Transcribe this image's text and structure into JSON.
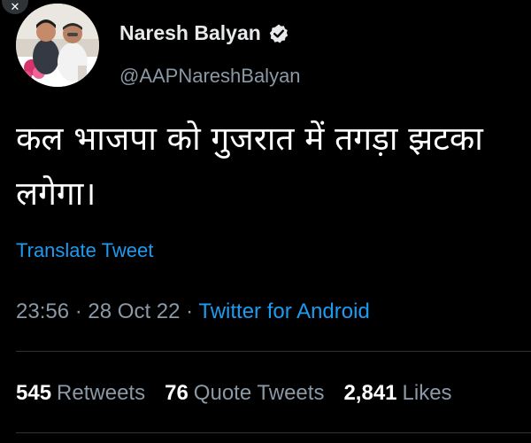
{
  "close_icon": "close-icon",
  "author": {
    "display_name": "Naresh Balyan",
    "handle": "@AAPNareshBalyan",
    "verified_icon": "verified-badge-icon",
    "verified_color": "#e7e9ea"
  },
  "tweet": {
    "text": "कल भाजपा को गुजरात में तगड़ा झटका\nलगेगा।",
    "translate_label": "Translate Tweet"
  },
  "meta": {
    "time": "23:56",
    "separator": "·",
    "date": "28 Oct 22",
    "source": "Twitter for Android"
  },
  "stats": {
    "retweets_count": "545",
    "retweets_label": "Retweets",
    "quotes_count": "76",
    "quotes_label": "Quote Tweets",
    "likes_count": "2,841",
    "likes_label": "Likes"
  },
  "colors": {
    "background": "#000000",
    "text_primary": "#e7e9ea",
    "text_secondary": "#8b98a5",
    "link": "#1d9bf0",
    "divider": "#2f3336"
  }
}
